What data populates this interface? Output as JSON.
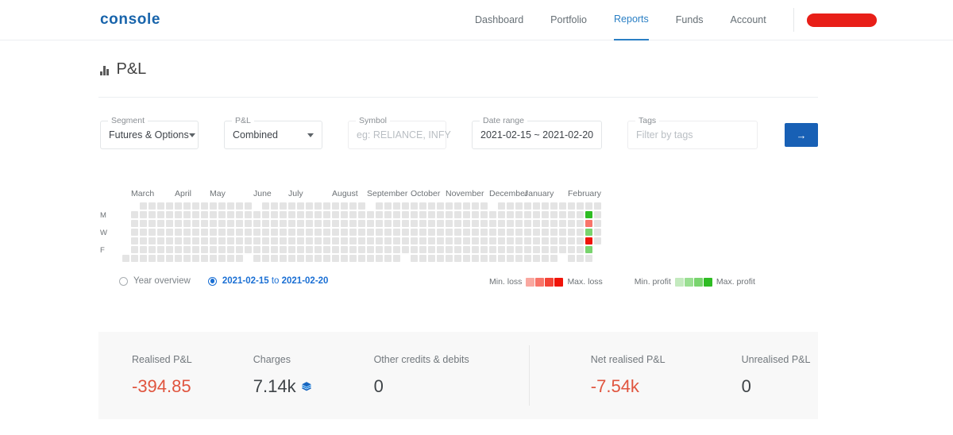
{
  "header": {
    "logo": "console",
    "nav": [
      {
        "label": "Dashboard",
        "active": false
      },
      {
        "label": "Portfolio",
        "active": false
      },
      {
        "label": "Reports",
        "active": true
      },
      {
        "label": "Funds",
        "active": false
      },
      {
        "label": "Account",
        "active": false
      }
    ],
    "user_redacted": ""
  },
  "page": {
    "title": "P&L",
    "title_icon": "bar-chart-icon"
  },
  "filters": {
    "segment": {
      "label": "Segment",
      "value": "Futures & Options"
    },
    "pl": {
      "label": "P&L",
      "value": "Combined"
    },
    "symbol": {
      "label": "Symbol",
      "placeholder": "eg: RELIANCE, INFY",
      "value": ""
    },
    "date_range": {
      "label": "Date range",
      "value": "2021-02-15 ~ 2021-02-20"
    },
    "tags": {
      "label": "Tags",
      "placeholder": "Filter by tags",
      "value": ""
    },
    "submit_label": "→"
  },
  "heatmap": {
    "months": [
      "March",
      "April",
      "May",
      "June",
      "July",
      "August",
      "September",
      "October",
      "November",
      "December",
      "January",
      "February"
    ],
    "day_labels": [
      "",
      "M",
      "",
      "W",
      "",
      "F",
      ""
    ],
    "default_color": "#e4e4e4",
    "view_options": [
      {
        "label": "Year overview",
        "selected": false
      },
      {
        "label_bold_start": "2021-02-15",
        "label_mid": " to ",
        "label_bold_end": "2021-02-20",
        "selected": true
      }
    ],
    "legends": [
      {
        "min_label": "Min. loss",
        "max_label": "Max. loss",
        "colors": [
          "#f9a8a0",
          "#f8756a",
          "#f44336",
          "#f01409"
        ]
      },
      {
        "min_label": "Min. profit",
        "max_label": "Max. profit",
        "colors": [
          "#c4eabf",
          "#9adf92",
          "#79d46e",
          "#2ebc23"
        ]
      }
    ],
    "highlight_column": {
      "month": "February",
      "cells": [
        "#e4e4e4",
        "#2ebc23",
        "#f8756a",
        "#79d46e",
        "#f01409",
        "#79d46e",
        "#e4e4e4"
      ]
    }
  },
  "summary": {
    "stats": [
      {
        "label": "Realised P&L",
        "value": "-394.85",
        "negative": true,
        "icon": ""
      },
      {
        "label": "Charges",
        "value": "7.14k",
        "negative": false,
        "icon": "layers-icon"
      },
      {
        "label": "Other credits & debits",
        "value": "0",
        "negative": false,
        "icon": ""
      },
      {
        "label": "Net realised P&L",
        "value": "-7.54k",
        "negative": true,
        "icon": ""
      },
      {
        "label": "Unrealised P&L",
        "value": "0",
        "negative": false,
        "icon": ""
      }
    ]
  },
  "colors": {
    "brand_blue": "#1864ab",
    "accent_blue": "#1860b5",
    "negative_red": "#e0553f",
    "redaction_red": "#e81f18"
  }
}
